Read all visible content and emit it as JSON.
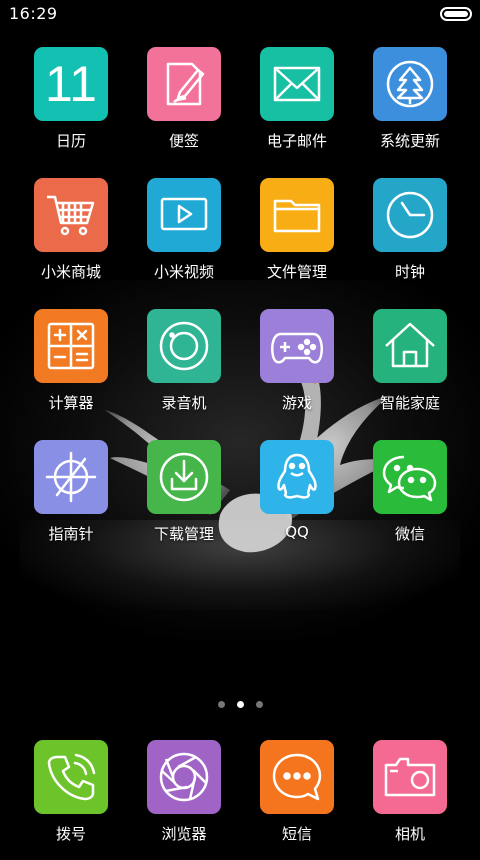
{
  "status_bar": {
    "time": "16:29",
    "battery_level": 1.0
  },
  "apps": [
    {
      "label": "日历",
      "color": "#13c1b2",
      "icon": "calendar-icon",
      "text": "11"
    },
    {
      "label": "便签",
      "color": "#f3729a",
      "icon": "notes-icon"
    },
    {
      "label": "电子邮件",
      "color": "#17bfa3",
      "icon": "mail-icon"
    },
    {
      "label": "系统更新",
      "color": "#3c8fdc",
      "icon": "update-icon"
    },
    {
      "label": "小米商城",
      "color": "#eb6a4a",
      "icon": "cart-icon"
    },
    {
      "label": "小米视频",
      "color": "#21a9d5",
      "icon": "video-icon"
    },
    {
      "label": "文件管理",
      "color": "#f9ad14",
      "icon": "folder-icon"
    },
    {
      "label": "时钟",
      "color": "#23a6c8",
      "icon": "clock-icon"
    },
    {
      "label": "计算器",
      "color": "#f17a22",
      "icon": "calculator-icon"
    },
    {
      "label": "录音机",
      "color": "#2fb494",
      "icon": "recorder-icon"
    },
    {
      "label": "游戏",
      "color": "#9b7fd9",
      "icon": "gamepad-icon"
    },
    {
      "label": "智能家庭",
      "color": "#26b27c",
      "icon": "home-icon"
    },
    {
      "label": "指南针",
      "color": "#8a8fe6",
      "icon": "compass-icon"
    },
    {
      "label": "下载管理",
      "color": "#47b64a",
      "icon": "download-icon"
    },
    {
      "label": "QQ",
      "color": "#2fb4ea",
      "icon": "qq-penguin-icon"
    },
    {
      "label": "微信",
      "color": "#2bbb3a",
      "icon": "wechat-icon"
    }
  ],
  "page_indicator": {
    "pages": 3,
    "current": 2
  },
  "dock": [
    {
      "label": "拨号",
      "color": "#6cc42a",
      "icon": "phone-icon"
    },
    {
      "label": "浏览器",
      "color": "#a063c6",
      "icon": "browser-icon"
    },
    {
      "label": "短信",
      "color": "#f5741e",
      "icon": "message-icon"
    },
    {
      "label": "相机",
      "color": "#f46a92",
      "icon": "camera-icon"
    }
  ]
}
